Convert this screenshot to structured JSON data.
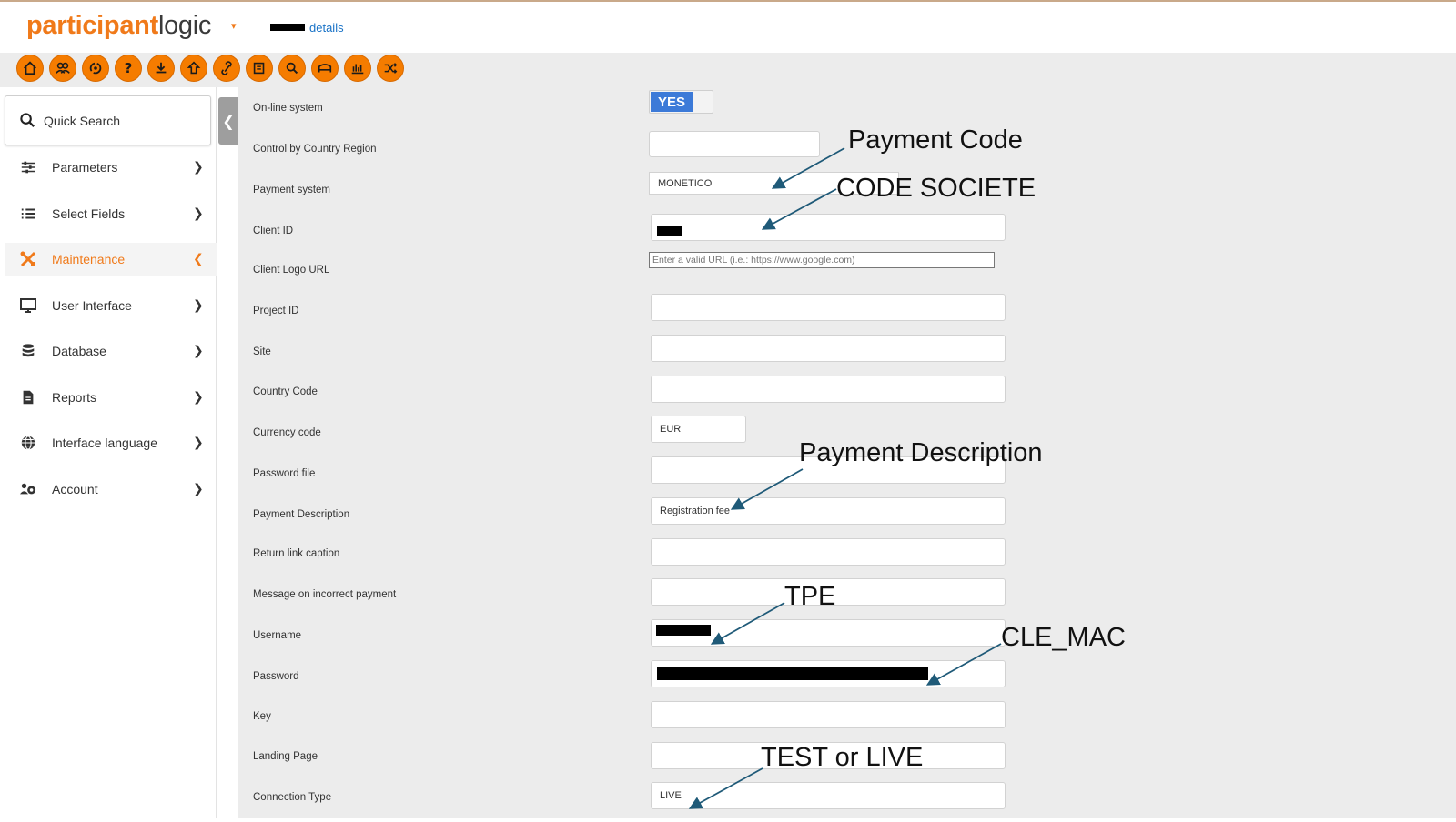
{
  "header": {
    "logo_part1": "participant",
    "logo_part2": "logic",
    "logo_caret": "▾",
    "details_link": "details"
  },
  "toolbar": {
    "icons": [
      "home-icon",
      "users-icon",
      "sync-icon",
      "help-icon",
      "download-icon",
      "upload-icon",
      "link-icon",
      "edit-icon",
      "search-icon",
      "hotel-icon",
      "chart-icon",
      "shuffle-icon"
    ]
  },
  "sidebar": {
    "quick_search": "Quick Search",
    "items": [
      {
        "label": "Parameters",
        "icon": "sliders-icon"
      },
      {
        "label": "Select Fields",
        "icon": "list-icon"
      },
      {
        "label": "Maintenance",
        "icon": "tools-icon",
        "active": true
      },
      {
        "label": "User Interface",
        "icon": "monitor-icon"
      },
      {
        "label": "Database",
        "icon": "database-icon"
      },
      {
        "label": "Reports",
        "icon": "report-icon"
      },
      {
        "label": "Interface language",
        "icon": "globe-icon"
      },
      {
        "label": "Account",
        "icon": "account-icon"
      }
    ]
  },
  "form": {
    "online_system": {
      "label": "On-line system",
      "value": "YES"
    },
    "control_by_country_region": {
      "label": "Control by Country Region",
      "value": ""
    },
    "payment_system": {
      "label": "Payment system",
      "value": "MONETICO"
    },
    "client_id": {
      "label": "Client ID",
      "value": ""
    },
    "client_logo_url": {
      "label": "Client Logo URL",
      "placeholder": "Enter a valid URL (i.e.: https://www.google.com)"
    },
    "project_id": {
      "label": "Project ID",
      "value": ""
    },
    "site": {
      "label": "Site",
      "value": ""
    },
    "country_code": {
      "label": "Country Code",
      "value": ""
    },
    "currency_code": {
      "label": "Currency code",
      "value": "EUR"
    },
    "password_file": {
      "label": "Password file",
      "value": ""
    },
    "payment_description": {
      "label": "Payment Description",
      "value": "Registration fee"
    },
    "return_link_caption": {
      "label": "Return link caption",
      "value": ""
    },
    "message_incorrect_payment": {
      "label": "Message on incorrect payment",
      "value": ""
    },
    "username": {
      "label": "Username",
      "value": ""
    },
    "password": {
      "label": "Password",
      "value": ""
    },
    "key": {
      "label": "Key",
      "value": ""
    },
    "landing_page": {
      "label": "Landing Page",
      "value": ""
    },
    "connection_type": {
      "label": "Connection Type",
      "value": "LIVE"
    }
  },
  "annotations": {
    "payment_code": "Payment Code",
    "code_societe": "CODE SOCIETE",
    "payment_description": "Payment Description",
    "tpe": "TPE",
    "cle_mac": "CLE_MAC",
    "test_or_live": "TEST or LIVE"
  }
}
